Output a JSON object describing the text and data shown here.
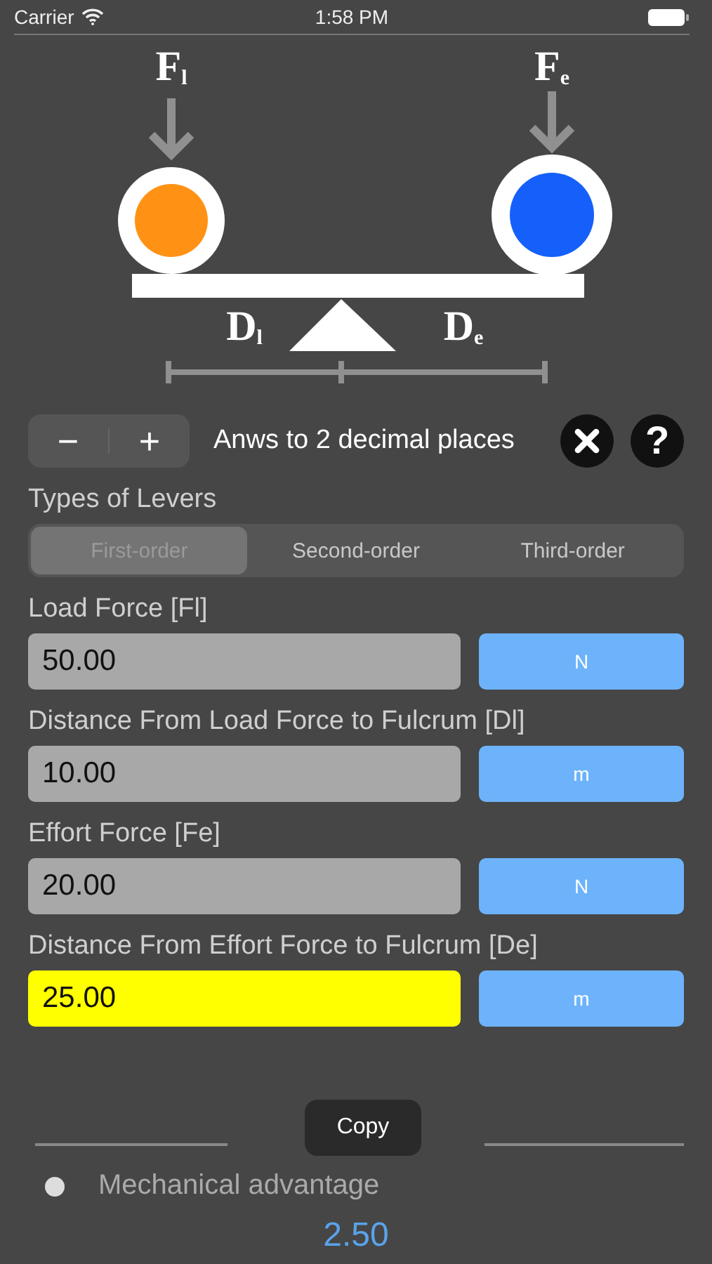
{
  "status_bar": {
    "carrier": "Carrier",
    "time": "1:58 PM"
  },
  "diagram": {
    "load_label": "F$_{l}$",
    "effort_label": "F$_{e}$",
    "load_distance_label": "D$_{l}$",
    "effort_distance_label": "D$_{e}$"
  },
  "precision": {
    "minus": "−",
    "plus": "+",
    "caption": "Anws to 2 decimal places",
    "help": "?"
  },
  "lever_types": {
    "label": "Types of Levers",
    "segments": [
      {
        "label": "First-order",
        "selected": true
      },
      {
        "label": "Second-order",
        "selected": false
      },
      {
        "label": "Third-order",
        "selected": false
      }
    ]
  },
  "inputs": [
    {
      "label": "Load Force [Fl]",
      "value": "50.00",
      "unit": "N",
      "highlighted": false
    },
    {
      "label": "Distance From Load Force to Fulcrum [Dl]",
      "value": "10.00",
      "unit": "m",
      "highlighted": false
    },
    {
      "label": "Effort Force [Fe]",
      "value": "20.00",
      "unit": "N",
      "highlighted": false
    },
    {
      "label": "Distance From Effort Force to Fulcrum [De]",
      "value": "25.00",
      "unit": "m",
      "highlighted": true
    }
  ],
  "results": {
    "tooltip": "Copy",
    "items": [
      {
        "label": "Mechanical advantage",
        "value": "2.50"
      }
    ]
  }
}
